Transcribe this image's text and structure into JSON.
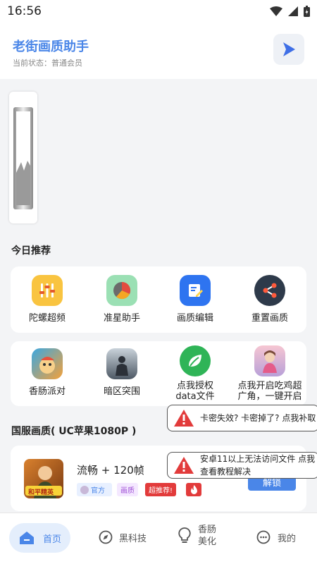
{
  "status_bar": {
    "time": "16:56"
  },
  "header": {
    "title": "老街画质助手",
    "subtitle": "当前状态：普通会员"
  },
  "sections": {
    "recommend_title": "今日推荐",
    "game_title": "国服画质( UC苹果1080P )"
  },
  "tools": [
    {
      "label": "陀螺超频",
      "icon": "sliders-icon",
      "color": "#f9c440"
    },
    {
      "label": "准星助手",
      "icon": "pie-chart-icon",
      "color": "#9be0b4"
    },
    {
      "label": "画质编辑",
      "icon": "edit-icon",
      "color": "#2e74f0"
    },
    {
      "label": "重置画质",
      "icon": "share-icon",
      "color": "#2e3a4a"
    }
  ],
  "games": [
    {
      "label": "香肠派对",
      "icon": "sausage-party-icon"
    },
    {
      "label": "暗区突围",
      "icon": "arena-breakout-icon"
    },
    {
      "label": "点我授权data文件",
      "icon": "leaf-icon"
    },
    {
      "label": "点我开启吃鸡超广角，一键开启",
      "icon": "character-avatar-icon"
    }
  ],
  "toasts": [
    {
      "text": "卡密失效? 卡密掉了? 点我补取"
    },
    {
      "text": "安卓11以上无法访问文件 点我查看教程解决"
    }
  ],
  "game_card": {
    "title": "流畅 + 120帧",
    "tags": [
      "官方",
      "画质",
      "超推荐!"
    ],
    "button": "解锁",
    "thumbnail_text": "和平精英"
  },
  "bottom_nav": [
    {
      "label": "首页",
      "icon": "home-icon",
      "active": true
    },
    {
      "label": "黑科技",
      "icon": "compass-icon",
      "active": false
    },
    {
      "label": "香肠美化",
      "icon": "lightbulb-icon",
      "active": false
    },
    {
      "label": "我的",
      "icon": "chat-bubble-icon",
      "active": false
    }
  ],
  "colors": {
    "accent": "#4a86e8",
    "danger": "#e23b3b",
    "background": "#f3f4f6"
  }
}
